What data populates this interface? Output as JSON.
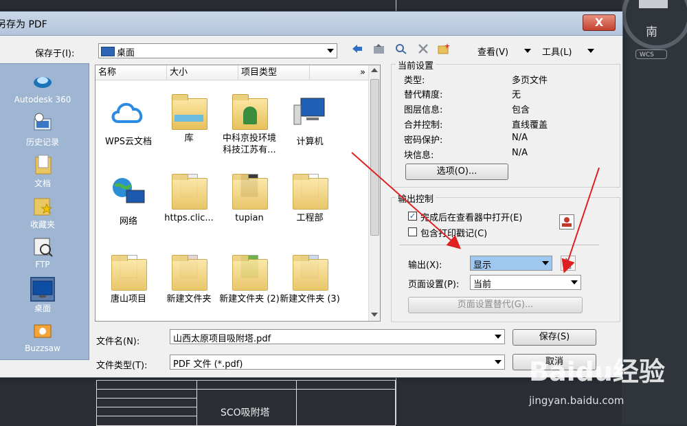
{
  "dialog": {
    "title": "另存为 PDF",
    "close_label": "X"
  },
  "toolbar": {
    "save_in_label": "保存于(I):",
    "save_in_value": "桌面",
    "view_label": "查看(V)",
    "tools_label": "工具(L)"
  },
  "sidebar": {
    "items": [
      {
        "label": "Autodesk 360"
      },
      {
        "label": "历史记录"
      },
      {
        "label": "文档"
      },
      {
        "label": "收藏夹"
      },
      {
        "label": "FTP"
      },
      {
        "label": "桌面"
      },
      {
        "label": "Buzzsaw"
      }
    ]
  },
  "filelist": {
    "columns": [
      "名称",
      "大小",
      "项目类型"
    ],
    "files": [
      {
        "name": "WPS云文档"
      },
      {
        "name": "库"
      },
      {
        "name": "中科京投环境科技江苏有..."
      },
      {
        "name": "计算机"
      },
      {
        "name": "网络"
      },
      {
        "name": "https.clic..."
      },
      {
        "name": "tupian"
      },
      {
        "name": "工程部"
      },
      {
        "name": "唐山项目"
      },
      {
        "name": "新建文件夹"
      },
      {
        "name": "新建文件夹 (2)"
      },
      {
        "name": "新建文件夹 (3)"
      }
    ]
  },
  "current_settings": {
    "title": "当前设置",
    "rows": [
      {
        "key": "类型:",
        "value": "多页文件"
      },
      {
        "key": "替代精度:",
        "value": "无"
      },
      {
        "key": "图层信息:",
        "value": "包含"
      },
      {
        "key": "合并控制:",
        "value": "直线覆盖"
      },
      {
        "key": "密码保护:",
        "value": "N/A"
      },
      {
        "key": "块信息:",
        "value": "N/A"
      }
    ],
    "options_button": "选项(O)..."
  },
  "output_control": {
    "title": "输出控制",
    "open_in_viewer": "完成后在查看器中打开(E)",
    "include_plot_stamp": "包含打印戳记(C)",
    "output_label": "输出(X):",
    "output_value": "显示",
    "page_setup_label": "页面设置(P):",
    "page_setup_value": "当前",
    "page_setup_override": "页面设置替代(G)..."
  },
  "bottom": {
    "filename_label": "文件名(N):",
    "filename_value": "山西太原项目吸附塔.pdf",
    "filetype_label": "文件类型(T):",
    "filetype_value": "PDF 文件 (*.pdf)",
    "save_button": "保存(S)",
    "cancel_button": "取消"
  },
  "cad": {
    "compass_label": "南",
    "wcs_label": "WCS",
    "titleblock_text": "SCO吸附塔"
  },
  "watermark": {
    "logo": "Baidu经验",
    "url": "jingyan.baidu.com"
  },
  "colors": {
    "accent_arrow": "#e02020",
    "highlight_combo": "#9ec8ef"
  }
}
